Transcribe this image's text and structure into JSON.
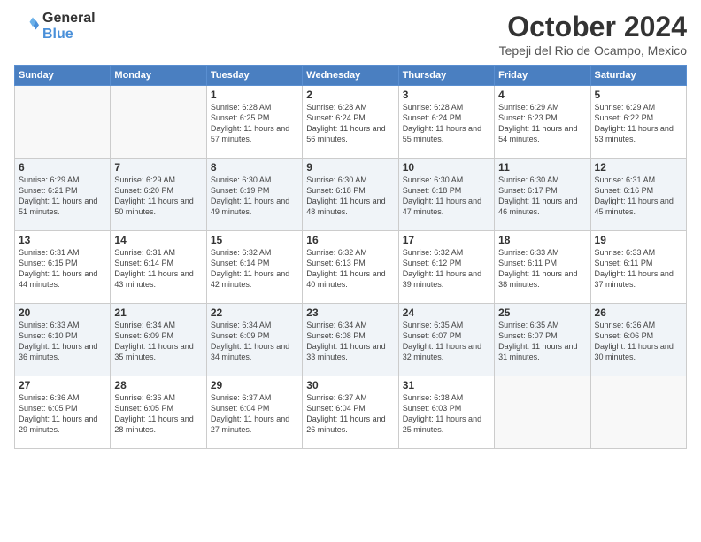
{
  "header": {
    "logo_general": "General",
    "logo_blue": "Blue",
    "month": "October 2024",
    "location": "Tepeji del Rio de Ocampo, Mexico"
  },
  "days_of_week": [
    "Sunday",
    "Monday",
    "Tuesday",
    "Wednesday",
    "Thursday",
    "Friday",
    "Saturday"
  ],
  "weeks": [
    [
      {
        "day": "",
        "info": ""
      },
      {
        "day": "",
        "info": ""
      },
      {
        "day": "1",
        "info": "Sunrise: 6:28 AM\nSunset: 6:25 PM\nDaylight: 11 hours and 57 minutes."
      },
      {
        "day": "2",
        "info": "Sunrise: 6:28 AM\nSunset: 6:24 PM\nDaylight: 11 hours and 56 minutes."
      },
      {
        "day": "3",
        "info": "Sunrise: 6:28 AM\nSunset: 6:24 PM\nDaylight: 11 hours and 55 minutes."
      },
      {
        "day": "4",
        "info": "Sunrise: 6:29 AM\nSunset: 6:23 PM\nDaylight: 11 hours and 54 minutes."
      },
      {
        "day": "5",
        "info": "Sunrise: 6:29 AM\nSunset: 6:22 PM\nDaylight: 11 hours and 53 minutes."
      }
    ],
    [
      {
        "day": "6",
        "info": "Sunrise: 6:29 AM\nSunset: 6:21 PM\nDaylight: 11 hours and 51 minutes."
      },
      {
        "day": "7",
        "info": "Sunrise: 6:29 AM\nSunset: 6:20 PM\nDaylight: 11 hours and 50 minutes."
      },
      {
        "day": "8",
        "info": "Sunrise: 6:30 AM\nSunset: 6:19 PM\nDaylight: 11 hours and 49 minutes."
      },
      {
        "day": "9",
        "info": "Sunrise: 6:30 AM\nSunset: 6:18 PM\nDaylight: 11 hours and 48 minutes."
      },
      {
        "day": "10",
        "info": "Sunrise: 6:30 AM\nSunset: 6:18 PM\nDaylight: 11 hours and 47 minutes."
      },
      {
        "day": "11",
        "info": "Sunrise: 6:30 AM\nSunset: 6:17 PM\nDaylight: 11 hours and 46 minutes."
      },
      {
        "day": "12",
        "info": "Sunrise: 6:31 AM\nSunset: 6:16 PM\nDaylight: 11 hours and 45 minutes."
      }
    ],
    [
      {
        "day": "13",
        "info": "Sunrise: 6:31 AM\nSunset: 6:15 PM\nDaylight: 11 hours and 44 minutes."
      },
      {
        "day": "14",
        "info": "Sunrise: 6:31 AM\nSunset: 6:14 PM\nDaylight: 11 hours and 43 minutes."
      },
      {
        "day": "15",
        "info": "Sunrise: 6:32 AM\nSunset: 6:14 PM\nDaylight: 11 hours and 42 minutes."
      },
      {
        "day": "16",
        "info": "Sunrise: 6:32 AM\nSunset: 6:13 PM\nDaylight: 11 hours and 40 minutes."
      },
      {
        "day": "17",
        "info": "Sunrise: 6:32 AM\nSunset: 6:12 PM\nDaylight: 11 hours and 39 minutes."
      },
      {
        "day": "18",
        "info": "Sunrise: 6:33 AM\nSunset: 6:11 PM\nDaylight: 11 hours and 38 minutes."
      },
      {
        "day": "19",
        "info": "Sunrise: 6:33 AM\nSunset: 6:11 PM\nDaylight: 11 hours and 37 minutes."
      }
    ],
    [
      {
        "day": "20",
        "info": "Sunrise: 6:33 AM\nSunset: 6:10 PM\nDaylight: 11 hours and 36 minutes."
      },
      {
        "day": "21",
        "info": "Sunrise: 6:34 AM\nSunset: 6:09 PM\nDaylight: 11 hours and 35 minutes."
      },
      {
        "day": "22",
        "info": "Sunrise: 6:34 AM\nSunset: 6:09 PM\nDaylight: 11 hours and 34 minutes."
      },
      {
        "day": "23",
        "info": "Sunrise: 6:34 AM\nSunset: 6:08 PM\nDaylight: 11 hours and 33 minutes."
      },
      {
        "day": "24",
        "info": "Sunrise: 6:35 AM\nSunset: 6:07 PM\nDaylight: 11 hours and 32 minutes."
      },
      {
        "day": "25",
        "info": "Sunrise: 6:35 AM\nSunset: 6:07 PM\nDaylight: 11 hours and 31 minutes."
      },
      {
        "day": "26",
        "info": "Sunrise: 6:36 AM\nSunset: 6:06 PM\nDaylight: 11 hours and 30 minutes."
      }
    ],
    [
      {
        "day": "27",
        "info": "Sunrise: 6:36 AM\nSunset: 6:05 PM\nDaylight: 11 hours and 29 minutes."
      },
      {
        "day": "28",
        "info": "Sunrise: 6:36 AM\nSunset: 6:05 PM\nDaylight: 11 hours and 28 minutes."
      },
      {
        "day": "29",
        "info": "Sunrise: 6:37 AM\nSunset: 6:04 PM\nDaylight: 11 hours and 27 minutes."
      },
      {
        "day": "30",
        "info": "Sunrise: 6:37 AM\nSunset: 6:04 PM\nDaylight: 11 hours and 26 minutes."
      },
      {
        "day": "31",
        "info": "Sunrise: 6:38 AM\nSunset: 6:03 PM\nDaylight: 11 hours and 25 minutes."
      },
      {
        "day": "",
        "info": ""
      },
      {
        "day": "",
        "info": ""
      }
    ]
  ]
}
